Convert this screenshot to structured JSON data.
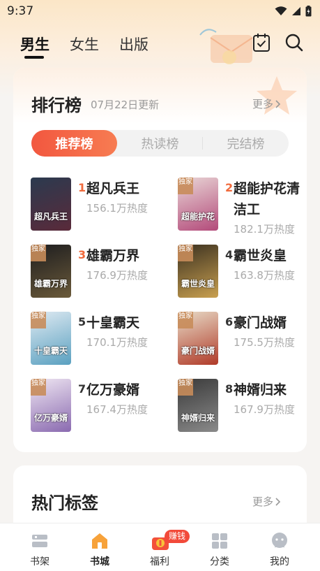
{
  "status_bar": {
    "time": "9:37"
  },
  "top_nav": {
    "tabs": [
      {
        "label": "男生",
        "active": true
      },
      {
        "label": "女生",
        "active": false
      },
      {
        "label": "出版",
        "active": false
      }
    ]
  },
  "ranking": {
    "title": "排行榜",
    "update": "07月22日更新",
    "more": "更多",
    "segments": [
      {
        "label": "推荐榜",
        "active": true
      },
      {
        "label": "热读榜",
        "active": false
      },
      {
        "label": "完结榜",
        "active": false
      }
    ],
    "books": [
      {
        "rank": "1",
        "name": "超凡兵王",
        "heat": "156.1万热度",
        "cover_text": "超凡兵王",
        "exclusive": false,
        "cover_colors": [
          "#2b3a4f",
          "#5a2a3a"
        ]
      },
      {
        "rank": "2",
        "name": "超能护花清洁工",
        "heat": "182.1万热度",
        "cover_text": "超能护花",
        "exclusive": true,
        "cover_colors": [
          "#e9d6d6",
          "#b34a7a"
        ]
      },
      {
        "rank": "3",
        "name": "雄霸万界",
        "heat": "176.9万热度",
        "cover_text": "雄霸万界",
        "exclusive": true,
        "cover_colors": [
          "#1d1d1f",
          "#6b5a3a"
        ]
      },
      {
        "rank": "4",
        "name": "霸世炎皇",
        "heat": "163.8万热度",
        "cover_text": "霸世炎皇",
        "exclusive": true,
        "cover_colors": [
          "#3a3020",
          "#c9a050"
        ]
      },
      {
        "rank": "5",
        "name": "十皇霸天",
        "heat": "170.1万热度",
        "cover_text": "十皇霸天",
        "exclusive": true,
        "cover_colors": [
          "#dfeaf2",
          "#5aa0c0"
        ]
      },
      {
        "rank": "6",
        "name": "豪门战婿",
        "heat": "175.5万热度",
        "cover_text": "豪门战婿",
        "exclusive": true,
        "cover_colors": [
          "#e8dcc8",
          "#b03a28"
        ]
      },
      {
        "rank": "7",
        "name": "亿万豪婿",
        "heat": "167.4万热度",
        "cover_text": "亿万豪婿",
        "exclusive": true,
        "cover_colors": [
          "#efe6f2",
          "#8a6ab0"
        ]
      },
      {
        "rank": "8",
        "name": "神婿归来",
        "heat": "167.9万热度",
        "cover_text": "神婿归来",
        "exclusive": true,
        "cover_colors": [
          "#3a3a3a",
          "#8a8a8a"
        ]
      }
    ],
    "rank_colors": {
      "top": "#f06a3c",
      "normal": "#333333"
    }
  },
  "hot_tags": {
    "title": "热门标签",
    "more": "更多"
  },
  "bottom_nav": {
    "items": [
      {
        "label": "书架",
        "icon": "bookshelf-icon",
        "active": false
      },
      {
        "label": "书城",
        "icon": "home-icon",
        "active": true
      },
      {
        "label": "福利",
        "icon": "gift-icon",
        "active": false
      },
      {
        "label": "分类",
        "icon": "category-icon",
        "active": false
      },
      {
        "label": "我的",
        "icon": "profile-icon",
        "active": false
      }
    ],
    "earn_badge": "赚钱"
  },
  "colors": {
    "accent": "#f2573f",
    "home_active": "#f7a23a"
  }
}
